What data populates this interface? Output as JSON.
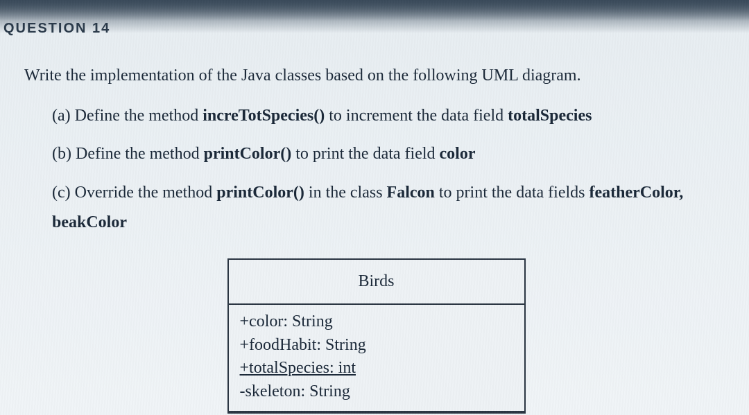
{
  "header": {
    "label": "QUESTION 14"
  },
  "prompt": {
    "main": "Write the implementation of the Java classes based on the following UML diagram.",
    "items": [
      {
        "marker": "(a)",
        "pre": " Define the method ",
        "bold1": "increTotSpecies()",
        "mid": " to increment the data field ",
        "bold2": "totalSpecies"
      },
      {
        "marker": "(b)",
        "pre": " Define the method ",
        "bold1": "printColor()",
        "mid": " to print the data field ",
        "bold2": "color"
      },
      {
        "marker": "(c)",
        "pre": " Override the method ",
        "bold1": "printColor()",
        "mid": " in the class ",
        "bold2": "Falcon",
        "post": " to print the data fields ",
        "bold3": "featherColor, beakColor"
      }
    ]
  },
  "uml": {
    "className": "Birds",
    "attributes": [
      {
        "text": "+color: String",
        "underline": false
      },
      {
        "text": "+foodHabit: String",
        "underline": false
      },
      {
        "text": "+totalSpecies: int",
        "underline": true
      },
      {
        "text": "-skeleton: String",
        "underline": false
      }
    ]
  }
}
